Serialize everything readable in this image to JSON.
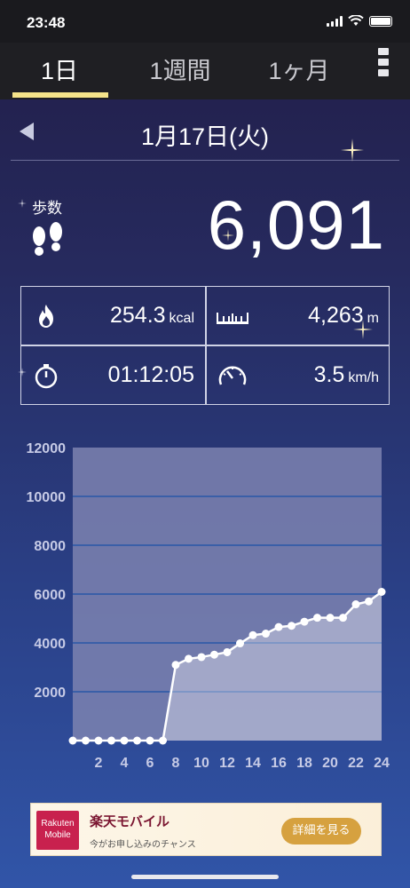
{
  "status_bar": {
    "time": "23:48"
  },
  "tabs": [
    {
      "label": "1日",
      "active": true
    },
    {
      "label": "1週間",
      "active": false
    },
    {
      "label": "1ヶ月",
      "active": false
    }
  ],
  "date": {
    "label": "1月17日(火)"
  },
  "steps": {
    "label": "歩数",
    "value": "6,091"
  },
  "stats": {
    "calories": {
      "value": "254.3",
      "unit": "kcal",
      "icon": "flame-icon"
    },
    "distance": {
      "value": "4,263",
      "unit": "m",
      "icon": "ruler-icon"
    },
    "duration": {
      "value": "01:12:05",
      "icon": "stopwatch-icon"
    },
    "speed": {
      "value": "3.5",
      "unit": "km/h",
      "icon": "speedometer-icon"
    }
  },
  "chart_data": {
    "type": "area",
    "x": [
      0,
      1,
      2,
      3,
      4,
      5,
      6,
      7,
      8,
      9,
      10,
      11,
      12,
      13,
      14,
      15,
      16,
      17,
      18,
      19,
      20,
      21,
      22,
      23,
      24
    ],
    "values": [
      0,
      0,
      0,
      0,
      0,
      0,
      0,
      0,
      3100,
      3350,
      3420,
      3520,
      3620,
      3980,
      4320,
      4380,
      4650,
      4700,
      4870,
      5030,
      5030,
      5030,
      5580,
      5700,
      6091
    ],
    "x_tick_labels": [
      "2",
      "4",
      "6",
      "8",
      "10",
      "12",
      "14",
      "16",
      "18",
      "20",
      "22",
      "24"
    ],
    "y_tick_labels": [
      "2000",
      "4000",
      "6000",
      "8000",
      "10000",
      "12000"
    ],
    "ylim": [
      0,
      12000
    ],
    "xlim": [
      0,
      24
    ],
    "grid": true,
    "colors": {
      "plot_bg": "#7c83b0",
      "line": "#ffffff",
      "grid": "#3a5fa8"
    }
  },
  "ad": {
    "logo": "Rakuten Mobile",
    "title": "楽天モバイル",
    "subtitle": "今がお申し込みのチャンス",
    "button": "詳細を見る"
  },
  "colors": {
    "tab_underline": "#f5e38a",
    "bg_top": "#211d47",
    "bg_bottom": "#3155a8"
  }
}
